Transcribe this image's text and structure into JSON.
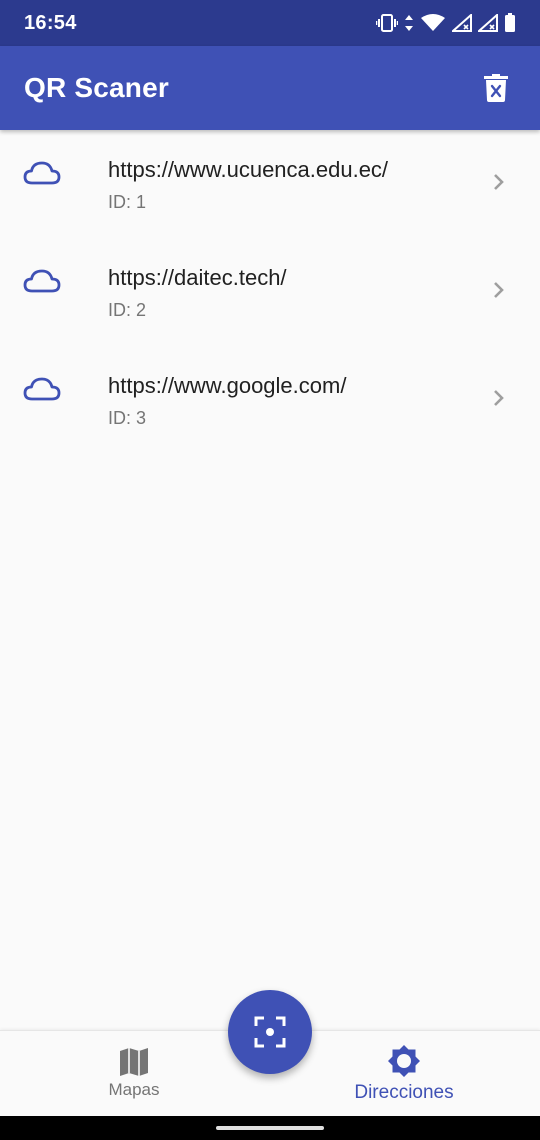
{
  "status_bar": {
    "time": "16:54",
    "icons": [
      "vibrate-icon",
      "data-arrows-icon",
      "wifi-icon",
      "signal-icon",
      "signal-icon",
      "battery-icon"
    ],
    "wifi_badge": "4"
  },
  "app_bar": {
    "title": "QR Scaner",
    "action_icon": "delete-sweep-icon"
  },
  "list": {
    "items": [
      {
        "url": "https://www.ucuenca.edu.ec/",
        "id": "ID: 1",
        "icon": "cloud-icon"
      },
      {
        "url": "https://daitec.tech/",
        "id": "ID: 2",
        "icon": "cloud-icon"
      },
      {
        "url": "https://www.google.com/",
        "id": "ID: 3",
        "icon": "cloud-icon"
      }
    ]
  },
  "fab": {
    "icon": "qr-scan-icon"
  },
  "bottom_nav": {
    "items": [
      {
        "label": "Mapas",
        "icon": "map-icon",
        "active": false
      },
      {
        "label": "Direcciones",
        "icon": "brightness-icon",
        "active": true
      }
    ]
  },
  "colors": {
    "primary": "#3f51b5",
    "status_bar": "#2c3a8e",
    "background": "#fafafa",
    "text_primary": "#212121",
    "text_secondary": "#757575"
  }
}
